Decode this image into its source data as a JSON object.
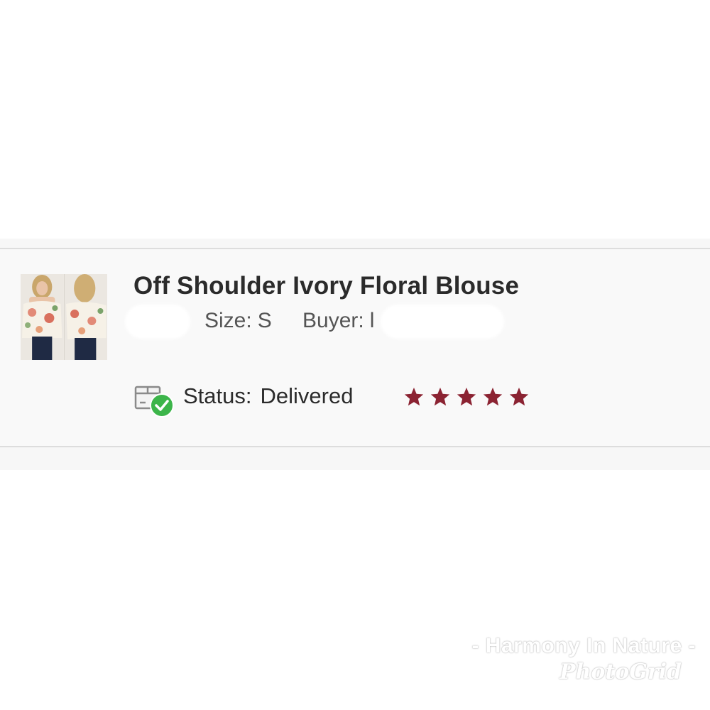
{
  "item": {
    "title": "Off Shoulder Ivory Floral Blouse",
    "size_label": "Size:",
    "size_value": "S",
    "buyer_label": "Buyer:",
    "buyer_value": "l",
    "status_label": "Status:",
    "status_value": "Delivered",
    "thumbnail_icon": "product-photo",
    "status_icon": "package-delivered-icon"
  },
  "rating": {
    "value": 5,
    "max": 5,
    "color": "#8b2332"
  },
  "colors": {
    "accent_check": "#3cb54a",
    "title_text": "#2b2b2b",
    "meta_text": "#555555"
  },
  "watermark": {
    "line1": "- Harmony In Nature -",
    "line2": "PhotoGrid"
  }
}
